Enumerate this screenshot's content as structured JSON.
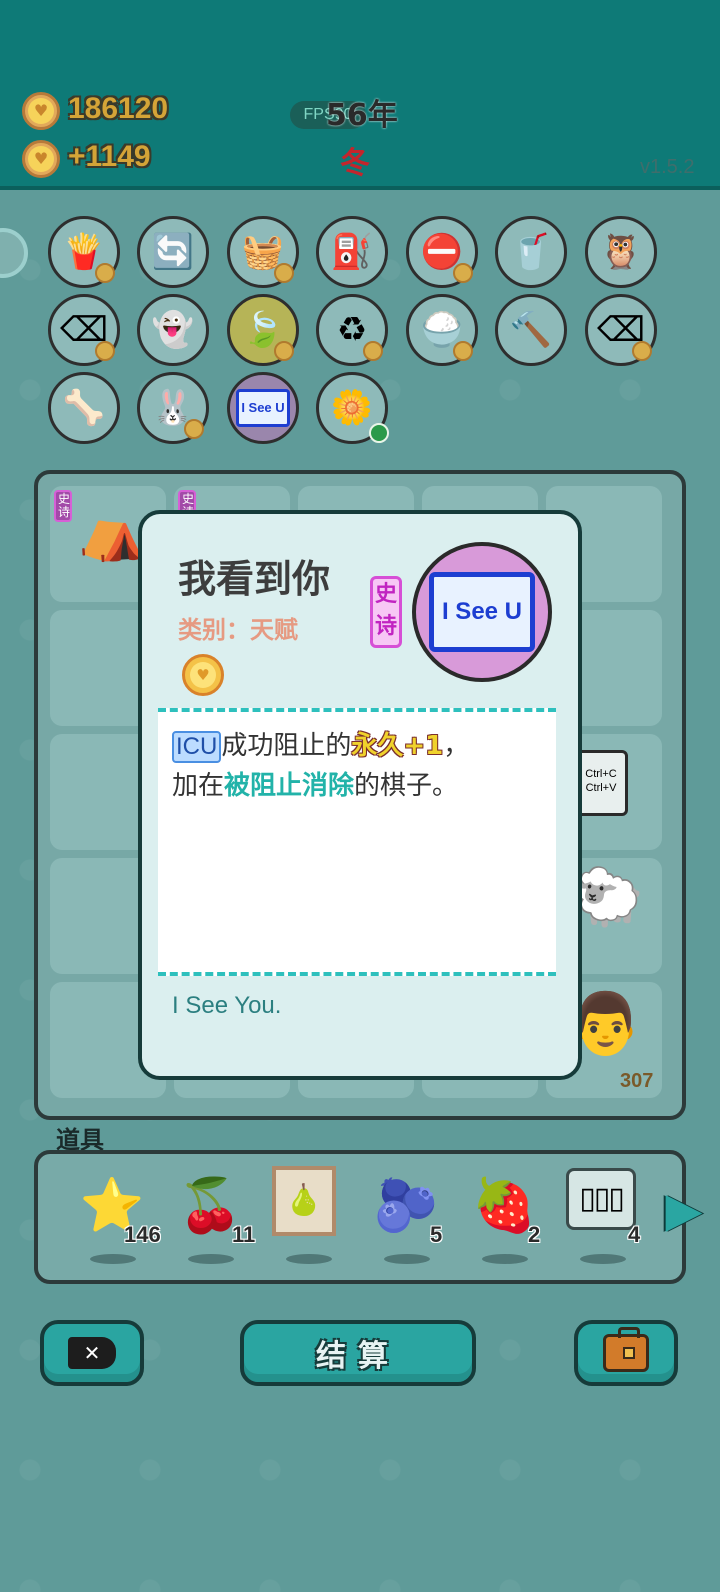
{
  "hud": {
    "coins": "186120",
    "income": "+1149",
    "fps": "FPS90",
    "year": "56年",
    "season": "冬",
    "version": "v1.5.2"
  },
  "card": {
    "title": "我看到你",
    "category": "类别：天赋",
    "rarity": "史诗",
    "portrait_text": "I See U",
    "desc": {
      "icu": "ICU",
      "part1": "成功阻止的",
      "gold": "永久+1",
      "part2": "，",
      "part3": "加在",
      "teal": "被阻止消除",
      "part4": "的棋子。"
    },
    "flavor": "I See You."
  },
  "board": {
    "tag_left": "史诗",
    "tag_second": "史诗",
    "copy_paste": "Ctrl+C\nCtrl+V",
    "counter": "307"
  },
  "items": {
    "label": "道具",
    "list": [
      {
        "icon": "star-fruit-icon",
        "count": "146"
      },
      {
        "icon": "bayberry-icon",
        "count": "11"
      },
      {
        "icon": "framed-fruit-icon",
        "count": ""
      },
      {
        "icon": "blueberry-icon",
        "count": "5"
      },
      {
        "icon": "strawberry-icon",
        "count": "2"
      },
      {
        "icon": "tiles-icon",
        "count": "4"
      }
    ]
  },
  "buttons": {
    "settle": "结算"
  },
  "portrait_small": "I See U"
}
